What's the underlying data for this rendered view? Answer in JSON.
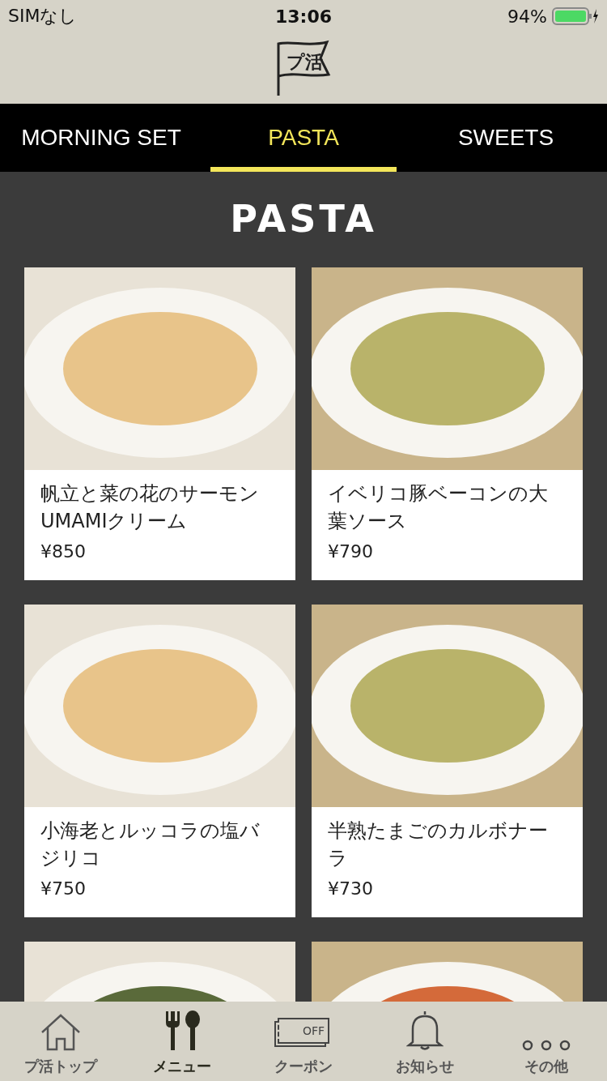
{
  "status_bar": {
    "carrier": "SIMなし",
    "time": "13:06",
    "battery": "94%"
  },
  "header": {
    "logo_text": "プ活"
  },
  "category_tabs": [
    {
      "label": "MORNING SET",
      "selected": false
    },
    {
      "label": "PASTA",
      "selected": true
    },
    {
      "label": "SWEETS",
      "selected": false
    }
  ],
  "section_title": "PASTA",
  "menu_items": [
    {
      "name": "帆立と菜の花のサーモンUMAMIクリーム",
      "price": "¥850"
    },
    {
      "name": "イベリコ豚ベーコンの大葉ソース",
      "price": "¥790"
    },
    {
      "name": "小海老とルッコラの塩バジリコ",
      "price": "¥750"
    },
    {
      "name": "半熟たまごのカルボナーラ",
      "price": "¥730"
    }
  ],
  "tab_bar": [
    {
      "kind": "home",
      "label": "プ活トップ",
      "selected": false
    },
    {
      "kind": "menu",
      "label": "メニュー",
      "selected": true
    },
    {
      "kind": "coupon",
      "label": "クーポン",
      "selected": false,
      "icon_text": "OFF"
    },
    {
      "kind": "news",
      "label": "お知らせ",
      "selected": false
    },
    {
      "kind": "more",
      "label": "その他",
      "selected": false
    }
  ]
}
